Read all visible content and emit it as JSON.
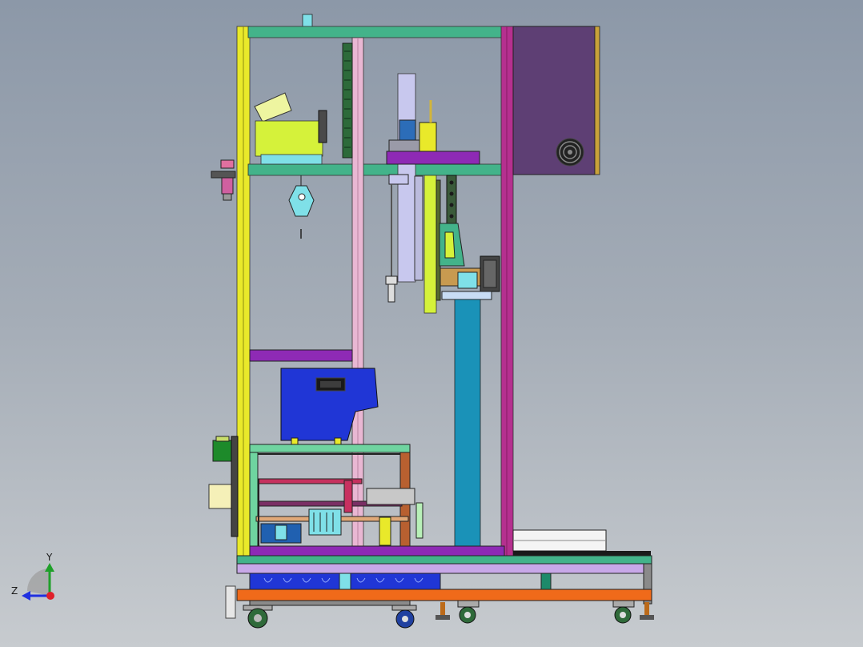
{
  "viewport": {
    "background_top": "#8c98a8",
    "background_bottom": "#c7cbcf"
  },
  "triad": {
    "y_label": "Y",
    "z_label": "Z",
    "x_color": "#e0202a",
    "y_color": "#1fa02a",
    "z_color": "#2030e0"
  },
  "colors": {
    "frame_yellow": "#e9e92a",
    "frame_green": "#43b38a",
    "frame_magenta": "#b5308f",
    "frame_purple": "#8e2ab5",
    "cabinet": "#5e3f74",
    "accent_lime": "#d5f23a",
    "hopper_blue": "#2036d6",
    "column_teal": "#1a92b8",
    "base_orange": "#f06a1a",
    "pink_rail": "#e9b7d3"
  }
}
